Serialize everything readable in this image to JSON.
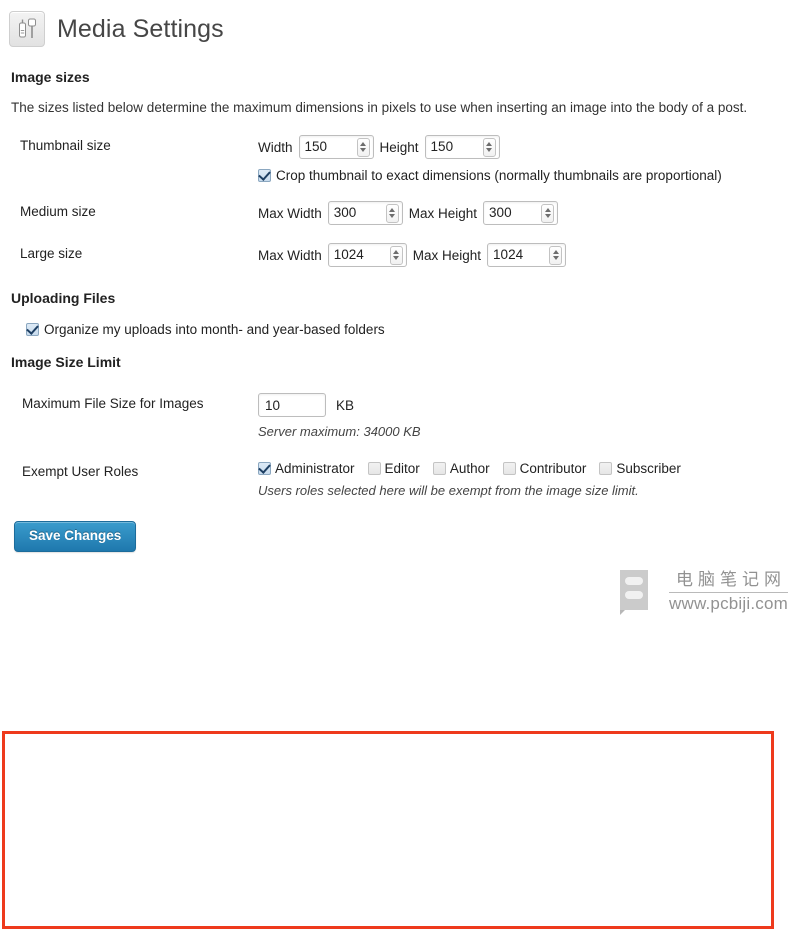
{
  "header": {
    "title": "Media Settings",
    "icon": "media-sliders-icon"
  },
  "image_sizes": {
    "heading": "Image sizes",
    "description": "The sizes listed below determine the maximum dimensions in pixels to use when inserting an image into the body of a post.",
    "rows": [
      {
        "label": "Thumbnail size",
        "fields": [
          {
            "label": "Width",
            "value": "150"
          },
          {
            "label": "Height",
            "value": "150"
          }
        ],
        "checkbox": {
          "label": "Crop thumbnail to exact dimensions (normally thumbnails are proportional)",
          "checked": true
        }
      },
      {
        "label": "Medium size",
        "fields": [
          {
            "label": "Max Width",
            "value": "300"
          },
          {
            "label": "Max Height",
            "value": "300"
          }
        ]
      },
      {
        "label": "Large size",
        "fields": [
          {
            "label": "Max Width",
            "value": "1024"
          },
          {
            "label": "Max Height",
            "value": "1024"
          }
        ]
      }
    ]
  },
  "uploading_files": {
    "heading": "Uploading Files",
    "checkbox": {
      "label": "Organize my uploads into month- and year-based folders",
      "checked": true
    }
  },
  "image_size_limit": {
    "heading": "Image Size Limit",
    "highlight_color": "#ee3a1c",
    "max_file_size": {
      "label": "Maximum File Size for Images",
      "value": "10",
      "unit": "KB",
      "note": "Server maximum: 34000 KB"
    },
    "exempt_roles": {
      "label": "Exempt User Roles",
      "note": "Users roles selected here will be exempt from the image size limit.",
      "options": [
        {
          "label": "Administrator",
          "checked": true
        },
        {
          "label": "Editor",
          "checked": false
        },
        {
          "label": "Author",
          "checked": false
        },
        {
          "label": "Contributor",
          "checked": false
        },
        {
          "label": "Subscriber",
          "checked": false
        }
      ]
    }
  },
  "footer": {
    "save_label": "Save Changes",
    "accent_color": "#2b8cbe"
  },
  "watermark": {
    "cn_text": "电脑笔记网",
    "url_text": "www.pcbiji.com"
  }
}
